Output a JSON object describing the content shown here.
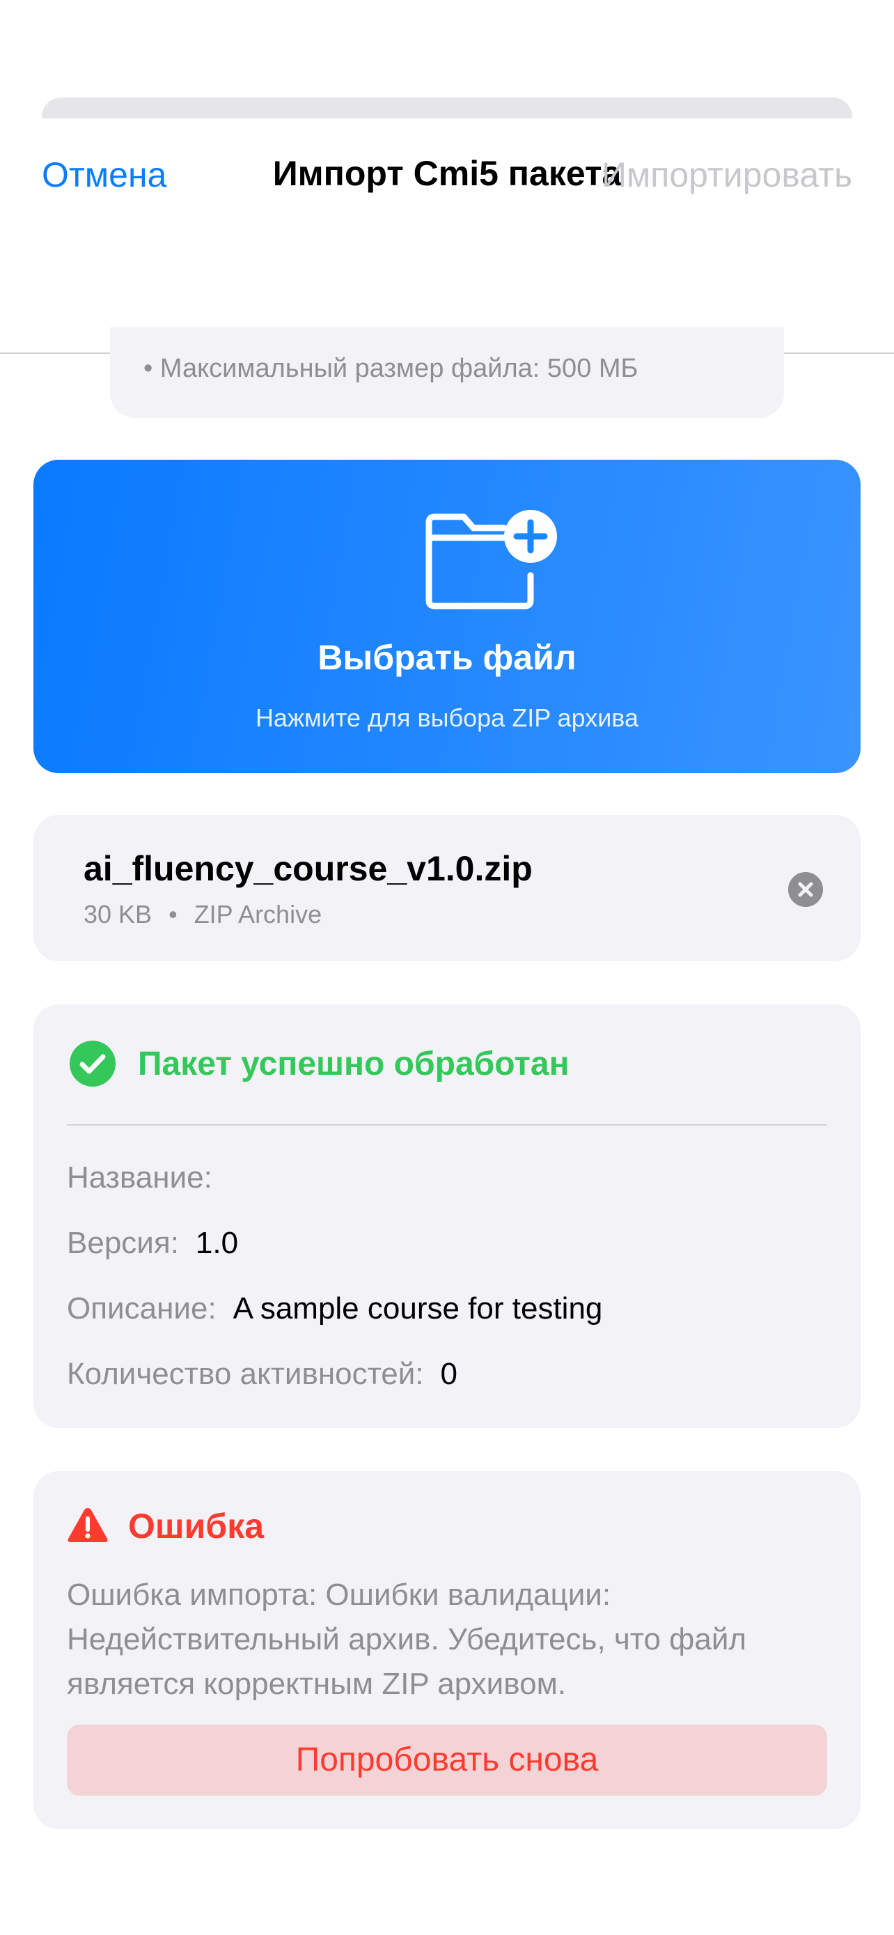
{
  "nav": {
    "cancel": "Отмена",
    "title": "Импорт Cmi5 пакета",
    "import": "Импортировать"
  },
  "info": {
    "max_size": "• Максимальный размер файла: 500 МБ"
  },
  "picker": {
    "icon": "folder-plus-icon",
    "title": "Выбрать файл",
    "subtitle": "Нажмите для выбора ZIP архива"
  },
  "file": {
    "name": "ai_fluency_course_v1.0.zip",
    "size": "30 KB",
    "separator": "•",
    "type": "ZIP Archive"
  },
  "result": {
    "status": "Пакет успешно обработан",
    "rows": [
      {
        "key": "Название:",
        "value": ""
      },
      {
        "key": "Версия:",
        "value": "1.0"
      },
      {
        "key": "Описание:",
        "value": "A sample course for testing"
      },
      {
        "key": "Количество активностей:",
        "value": "0"
      }
    ]
  },
  "error": {
    "title": "Ошибка",
    "message": "Ошибка импорта: Ошибки валидации: Недействительный архив. Убедитесь, что файл является корректным ZIP архивом.",
    "retry": "Попробовать снова"
  },
  "colors": {
    "accent": "#0a7cff",
    "success": "#34c759",
    "danger": "#ff3b30",
    "card": "#f2f2f7"
  }
}
